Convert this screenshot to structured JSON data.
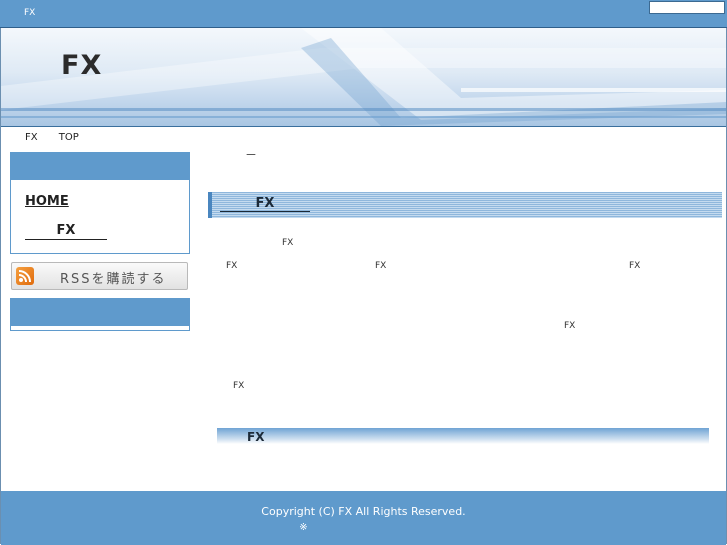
{
  "topbar": {
    "site_name": "FX"
  },
  "header": {
    "title": "FX"
  },
  "breadcrumb": {
    "items": [
      "FX",
      "TOP"
    ]
  },
  "sidebar": {
    "home_label": "HOME",
    "fx_label": "FX",
    "rss_label": "RSSを購読する"
  },
  "main": {
    "dash": "－",
    "section_title": "FX",
    "texts": [
      "FX",
      "FX",
      "FX",
      "FX",
      "FX",
      "FX"
    ],
    "sub_title": "FX"
  },
  "footer": {
    "copyright": "Copyright (C)  FX      All Rights Reserved.",
    "note": "※"
  },
  "colors": {
    "accent": "#5f9acc",
    "accent_dark": "#2f5f8a"
  }
}
